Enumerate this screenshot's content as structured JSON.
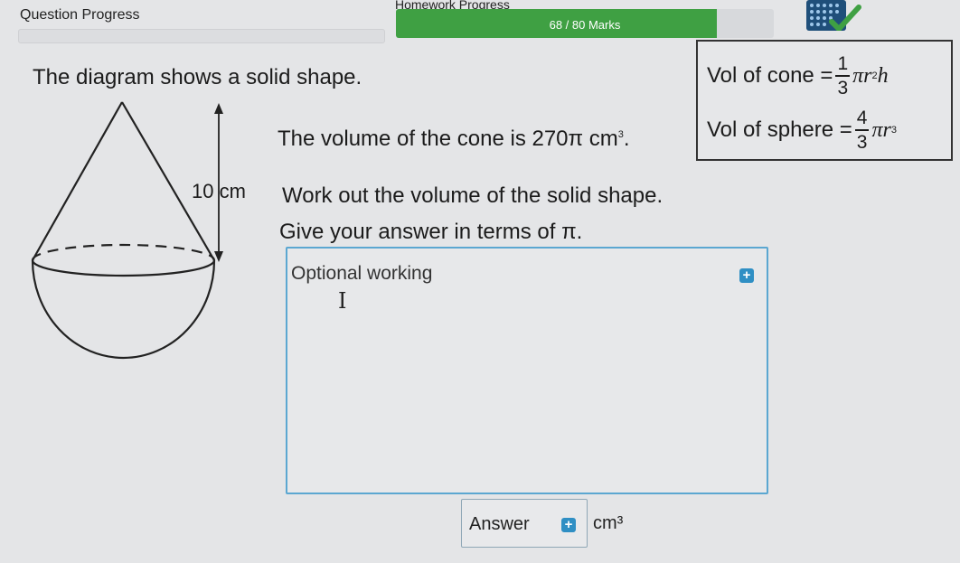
{
  "header": {
    "question_progress_label": "Question Progress",
    "homework_progress_label": "Homework Progress",
    "marks_text": "68 / 80 Marks",
    "marks_fraction": 0.85,
    "accent_green": "#3fa043"
  },
  "question": {
    "intro": "The diagram shows a solid shape.",
    "cone_volume_text": "The volume of the cone is 270π cm",
    "cone_volume_exp": "3",
    "cone_volume_end": ".",
    "task_line1": "Work out the volume of the solid shape.",
    "task_line2": "Give your answer in terms of π.",
    "diagram_label": "10 cm"
  },
  "formulas": {
    "cone_prefix": "Vol of cone =",
    "cone_num": "1",
    "cone_den": "3",
    "cone_pi": "π",
    "cone_r": "r",
    "cone_r_exp": "2",
    "cone_h": "h",
    "sphere_prefix": "Vol of sphere =",
    "sphere_num": "4",
    "sphere_den": "3",
    "sphere_pi": "π",
    "sphere_r": "r",
    "sphere_r_exp": "3"
  },
  "working": {
    "label": "Optional working",
    "plus_icon": "plus-icon",
    "cursor_glyph": "I"
  },
  "answer": {
    "label": "Answer",
    "unit": "cm³"
  }
}
